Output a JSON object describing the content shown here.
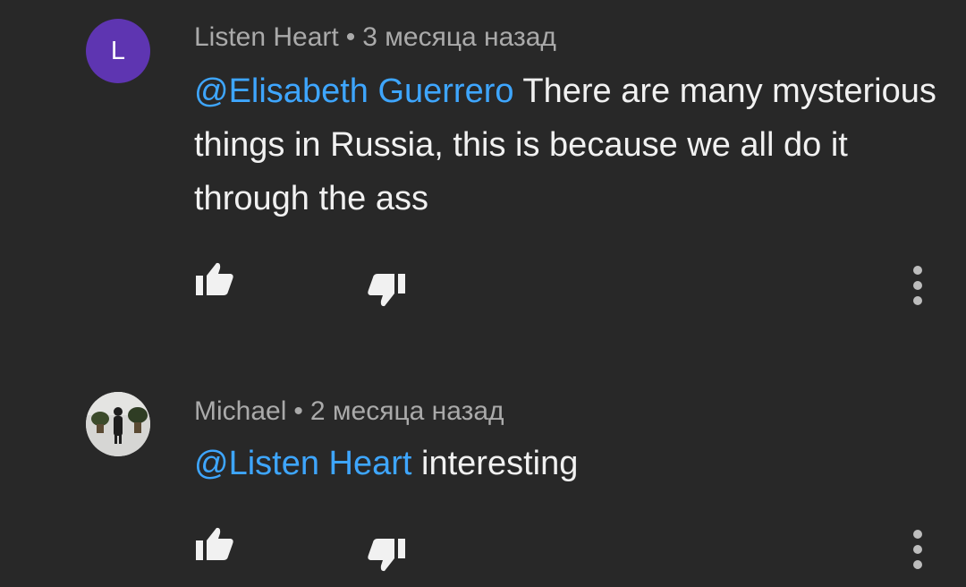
{
  "comments": [
    {
      "author": "Listen Heart",
      "separator": "•",
      "time": "3 месяца назад",
      "avatar_letter": "L",
      "avatar_color": "#5e35b1",
      "mention": "@Elisabeth Guerrero",
      "text": "There are many mysterious things in Russia, this is because we all do it through the ass",
      "icons": {
        "like": "thumbs-up-icon",
        "dislike": "thumbs-down-icon",
        "menu": "more-vert-icon"
      }
    },
    {
      "author": "Michael",
      "separator": "•",
      "time": "2 месяца назад",
      "mention": "@Listen Heart",
      "text": "interesting",
      "icons": {
        "like": "thumbs-up-icon",
        "dislike": "thumbs-down-icon",
        "menu": "more-vert-icon"
      }
    }
  ],
  "colors": {
    "background": "#282828",
    "mention": "#3ea6ff",
    "text": "#f1f1f1",
    "meta": "#aaaaaa"
  }
}
